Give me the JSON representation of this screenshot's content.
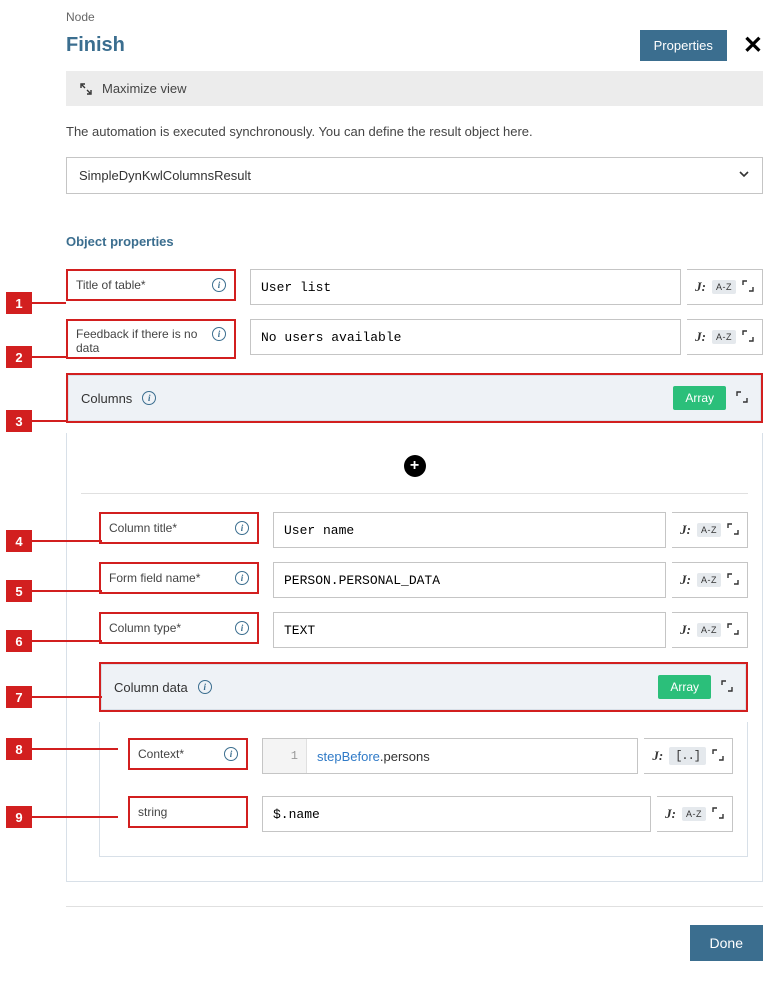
{
  "header": {
    "breadcrumb": "Node",
    "title": "Finish",
    "properties_btn": "Properties"
  },
  "maximize_label": "Maximize view",
  "description": "The automation is executed synchronously. You can define the result object here.",
  "result_type": "SimpleDynKwlColumnsResult",
  "section_title": "Object properties",
  "labels": {
    "title_of_table": "Title of table*",
    "feedback_no_data": "Feedback if there is no data",
    "columns": "Columns",
    "column_title": "Column title*",
    "form_field_name": "Form field name*",
    "column_type": "Column type*",
    "column_data": "Column data",
    "context": "Context*",
    "string": "string"
  },
  "values": {
    "title_of_table": "User list",
    "feedback_no_data": "No users available",
    "column_title": "User name",
    "form_field_name": "PERSON.PERSONAL_DATA",
    "column_type": "TEXT",
    "context_prefix": "stepBefore",
    "context_suffix": ".persons",
    "string_value": "$.name"
  },
  "badges": {
    "array": "Array",
    "j": "J:",
    "az": "A-Z",
    "brackets": "[..]"
  },
  "code_line": "1",
  "done_btn": "Done",
  "callouts": [
    "1",
    "2",
    "3",
    "4",
    "5",
    "6",
    "7",
    "8",
    "9"
  ]
}
